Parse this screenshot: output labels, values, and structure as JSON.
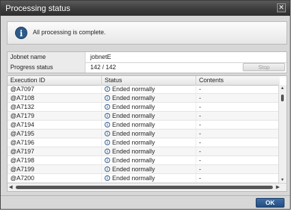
{
  "window": {
    "title": "Processing status",
    "close_label": "✕"
  },
  "message": {
    "icon": "info-icon",
    "text": "All processing is complete."
  },
  "properties": {
    "jobnet_label": "Jobnet name",
    "jobnet_value": "jobnetE",
    "progress_label": "Progress status",
    "progress_value": "142 / 142",
    "stop_label": "Stop"
  },
  "table": {
    "columns": [
      "Execution ID",
      "Status",
      "Contents"
    ],
    "rows": [
      {
        "id": "@A7097",
        "status": "Ended normally",
        "contents": "-"
      },
      {
        "id": "@A7108",
        "status": "Ended normally",
        "contents": "-"
      },
      {
        "id": "@A7132",
        "status": "Ended normally",
        "contents": "-"
      },
      {
        "id": "@A7179",
        "status": "Ended normally",
        "contents": "-"
      },
      {
        "id": "@A7194",
        "status": "Ended normally",
        "contents": "-"
      },
      {
        "id": "@A7195",
        "status": "Ended normally",
        "contents": "-"
      },
      {
        "id": "@A7196",
        "status": "Ended normally",
        "contents": "-"
      },
      {
        "id": "@A7197",
        "status": "Ended normally",
        "contents": "-"
      },
      {
        "id": "@A7198",
        "status": "Ended normally",
        "contents": "-"
      },
      {
        "id": "@A7199",
        "status": "Ended normally",
        "contents": "-"
      },
      {
        "id": "@A7200",
        "status": "Ended normally",
        "contents": "-"
      }
    ]
  },
  "footer": {
    "ok_label": "OK"
  }
}
